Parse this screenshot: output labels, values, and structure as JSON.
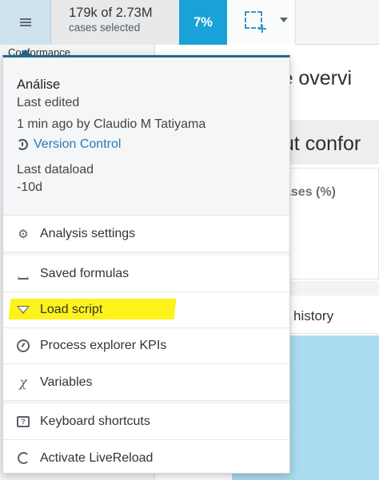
{
  "toolbar": {
    "cases_count": "179k of 2.73M",
    "cases_label": "cases selected",
    "percent": "7%",
    "accent_color": "#1aa1d8"
  },
  "background": {
    "left_peek": "Conformance",
    "title_fragment": "ce overvi",
    "subtitle_fragment": "out confor",
    "cases_fragment": "ases (%)",
    "history_fragment": "history"
  },
  "menu": {
    "analysis_name": "Análise",
    "last_edited_label": "Last edited",
    "last_edited_value": "1 min ago by Claudio M Tatiyama",
    "version_control": "Version Control",
    "last_dataload_label": "Last dataload",
    "last_dataload_value": "-10d",
    "items": [
      {
        "label": "Analysis settings",
        "icon": "gear-icon"
      },
      {
        "label": "Saved formulas",
        "icon": "flask-icon"
      },
      {
        "label": "Load script",
        "icon": "filter-icon"
      },
      {
        "label": "Process explorer KPIs",
        "icon": "gauge-icon"
      },
      {
        "label": "Variables",
        "icon": "variable-icon"
      },
      {
        "label": "Keyboard shortcuts",
        "icon": "keyboard-icon"
      },
      {
        "label": "Activate LiveReload",
        "icon": "refresh-icon"
      }
    ],
    "highlight_color": "#fdf21a"
  }
}
